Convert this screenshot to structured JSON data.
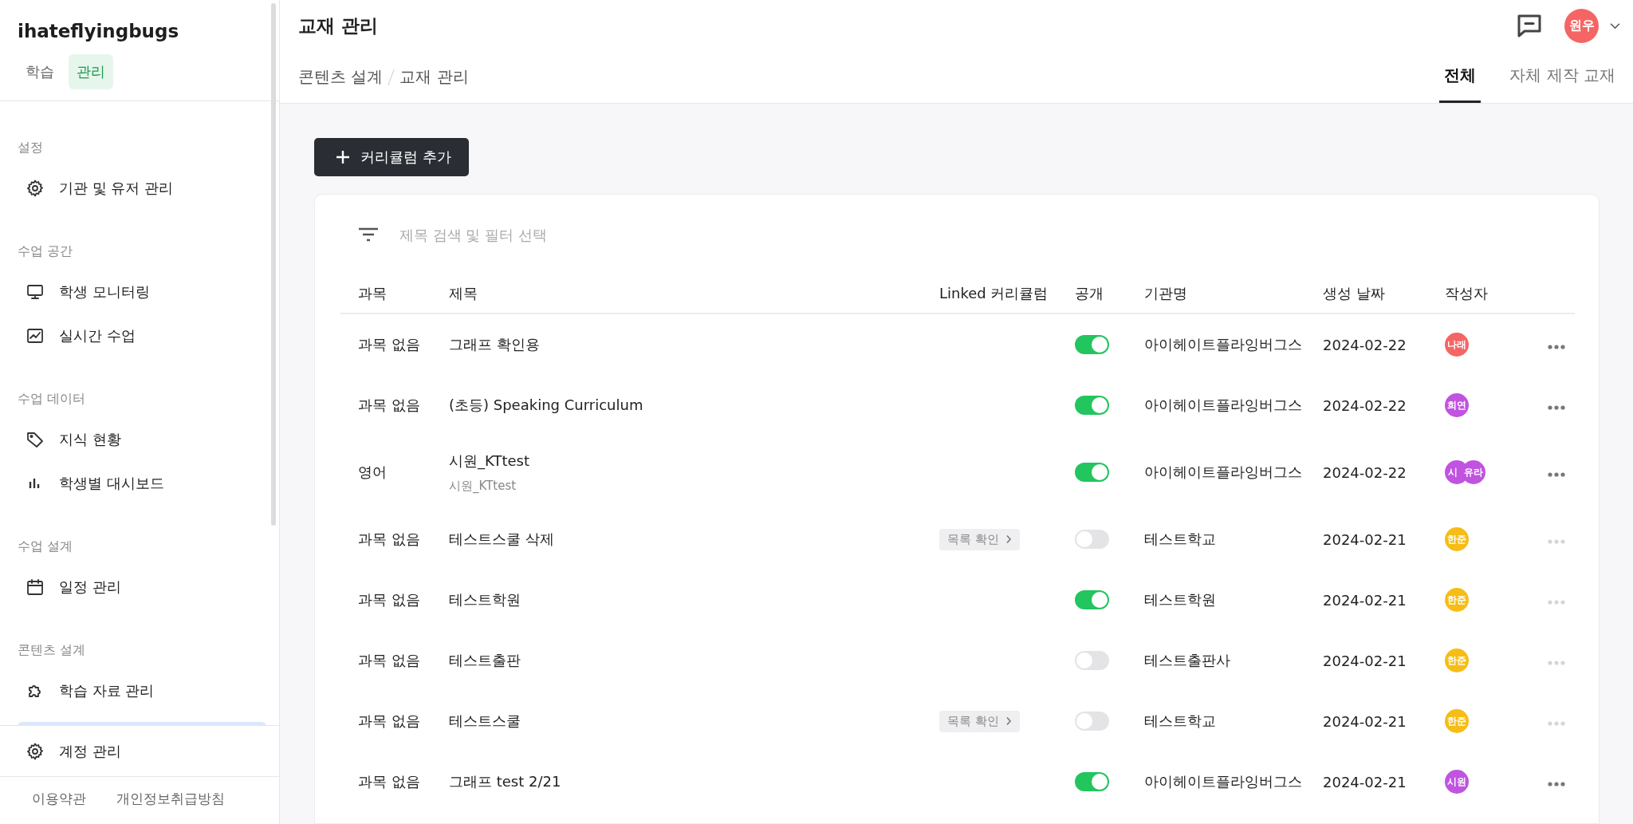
{
  "sidebar": {
    "brand": "ihateflyingbugs",
    "modes": [
      {
        "label": "학습",
        "selected": false
      },
      {
        "label": "관리",
        "selected": true
      }
    ],
    "sections": [
      {
        "title": "설정",
        "items": [
          {
            "label": "기관 및 유저 관리"
          }
        ]
      },
      {
        "title": "수업 공간",
        "items": [
          {
            "label": "학생 모니터링"
          },
          {
            "label": "실시간 수업"
          }
        ]
      },
      {
        "title": "수업 데이터",
        "items": [
          {
            "label": "지식 현황"
          },
          {
            "label": "학생별 대시보드"
          }
        ]
      },
      {
        "title": "수업 설계",
        "items": [
          {
            "label": "일정 관리"
          }
        ]
      },
      {
        "title": "콘텐츠 설계",
        "items": [
          {
            "label": "학습 자료 관리"
          }
        ]
      }
    ],
    "account": "계정 관리",
    "footer_links": [
      "이용약관",
      "개인정보취급방침"
    ]
  },
  "header": {
    "title": "교재 관리",
    "breadcrumb": [
      "콘텐츠 설계",
      "교재 관리"
    ],
    "user": "원우",
    "tabs": [
      {
        "label": "전체",
        "selected": true
      },
      {
        "label": "자체 제작 교재",
        "selected": false
      }
    ]
  },
  "add_button": "커리큘럼 추가",
  "search": {
    "placeholder": "제목 검색 및 필터 선택"
  },
  "table": {
    "columns": [
      "과목",
      "제목",
      "Linked 커리큘럼",
      "공개",
      "기관명",
      "생성 날짜",
      "작성자"
    ],
    "rows": [
      {
        "subject": "과목 없음",
        "title": "그래프 확인용",
        "public": true,
        "org": "아이헤이트플라잉버그스",
        "date": "2024-02-22",
        "authors": [
          {
            "initials": "나래",
            "color": "#f56565"
          }
        ],
        "menu_disabled": false
      },
      {
        "subject": "과목 없음",
        "title": "(초등) Speaking Curriculum",
        "public": true,
        "org": "아이헤이트플라잉버그스",
        "date": "2024-02-22",
        "authors": [
          {
            "initials": "희연",
            "color": "#c054e0"
          }
        ],
        "menu_disabled": false
      },
      {
        "subject": "영어",
        "title": "시원_KTtest",
        "subtitle": "시원_KTtest",
        "public": true,
        "org": "아이헤이트플라잉버그스",
        "date": "2024-02-22",
        "authors": [
          {
            "initials": "시",
            "color": "#c054e0"
          },
          {
            "initials": "유라",
            "color": "#c054e0"
          }
        ],
        "menu_disabled": false
      },
      {
        "subject": "과목 없음",
        "title": "테스트스쿨 삭제",
        "linked": "목록 확인",
        "public": false,
        "org": "테스트학교",
        "date": "2024-02-21",
        "authors": [
          {
            "initials": "한준",
            "color": "#f6bd16"
          }
        ],
        "menu_disabled": true
      },
      {
        "subject": "과목 없음",
        "title": "테스트학원",
        "public": true,
        "org": "테스트학원",
        "date": "2024-02-21",
        "authors": [
          {
            "initials": "한준",
            "color": "#f6bd16"
          }
        ],
        "menu_disabled": true
      },
      {
        "subject": "과목 없음",
        "title": "테스트출판",
        "public": false,
        "org": "테스트출판사",
        "date": "2024-02-21",
        "authors": [
          {
            "initials": "한준",
            "color": "#f6bd16"
          }
        ],
        "menu_disabled": true
      },
      {
        "subject": "과목 없음",
        "title": "테스트스쿨",
        "linked": "목록 확인",
        "public": false,
        "org": "테스트학교",
        "date": "2024-02-21",
        "authors": [
          {
            "initials": "한준",
            "color": "#f6bd16"
          }
        ],
        "menu_disabled": true
      },
      {
        "subject": "과목 없음",
        "title": "그래프 test 2/21",
        "public": true,
        "org": "아이헤이트플라잉버그스",
        "date": "2024-02-21",
        "authors": [
          {
            "initials": "시원",
            "color": "#c054e0"
          }
        ],
        "menu_disabled": false
      }
    ]
  }
}
